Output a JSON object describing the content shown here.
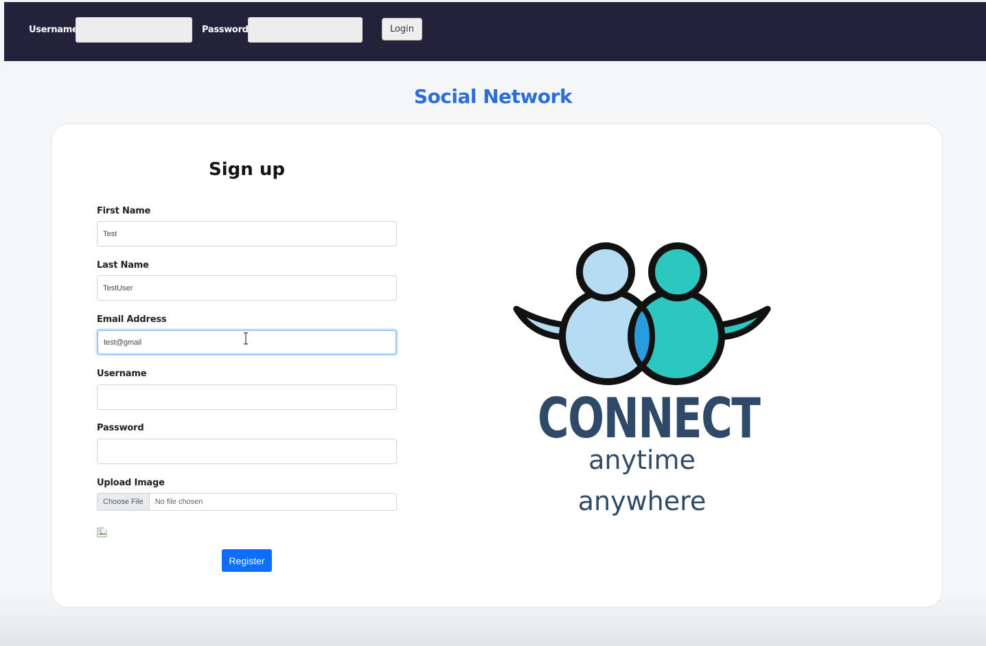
{
  "topbar": {
    "username_label": "Username",
    "username_value": "",
    "password_label": "Password",
    "password_value": "",
    "login_label": "Login"
  },
  "site": {
    "title": "Social Network"
  },
  "signup": {
    "title": "Sign up",
    "first_name": {
      "label": "First Name",
      "value": "Test"
    },
    "last_name": {
      "label": "Last Name",
      "value": "TestUser"
    },
    "email": {
      "label": "Email Address",
      "value": "test@gmail"
    },
    "username": {
      "label": "Username",
      "value": ""
    },
    "password": {
      "label": "Password",
      "value": ""
    },
    "upload": {
      "label": "Upload Image",
      "button": "Choose File",
      "status": "No file chosen"
    },
    "register_label": "Register"
  },
  "logo": {
    "word1": "CONNECT",
    "word2": "anytime",
    "word3": "anywhere",
    "colors": {
      "left_person": "#b5dcf2",
      "right_person": "#2cc7bf",
      "overlap": "#2a9bdc",
      "outline": "#111111",
      "text": "#2f4a68"
    }
  },
  "colors": {
    "topbar_bg": "#22223b",
    "accent": "#2b6fd6",
    "primary_button": "#0d6efd"
  }
}
